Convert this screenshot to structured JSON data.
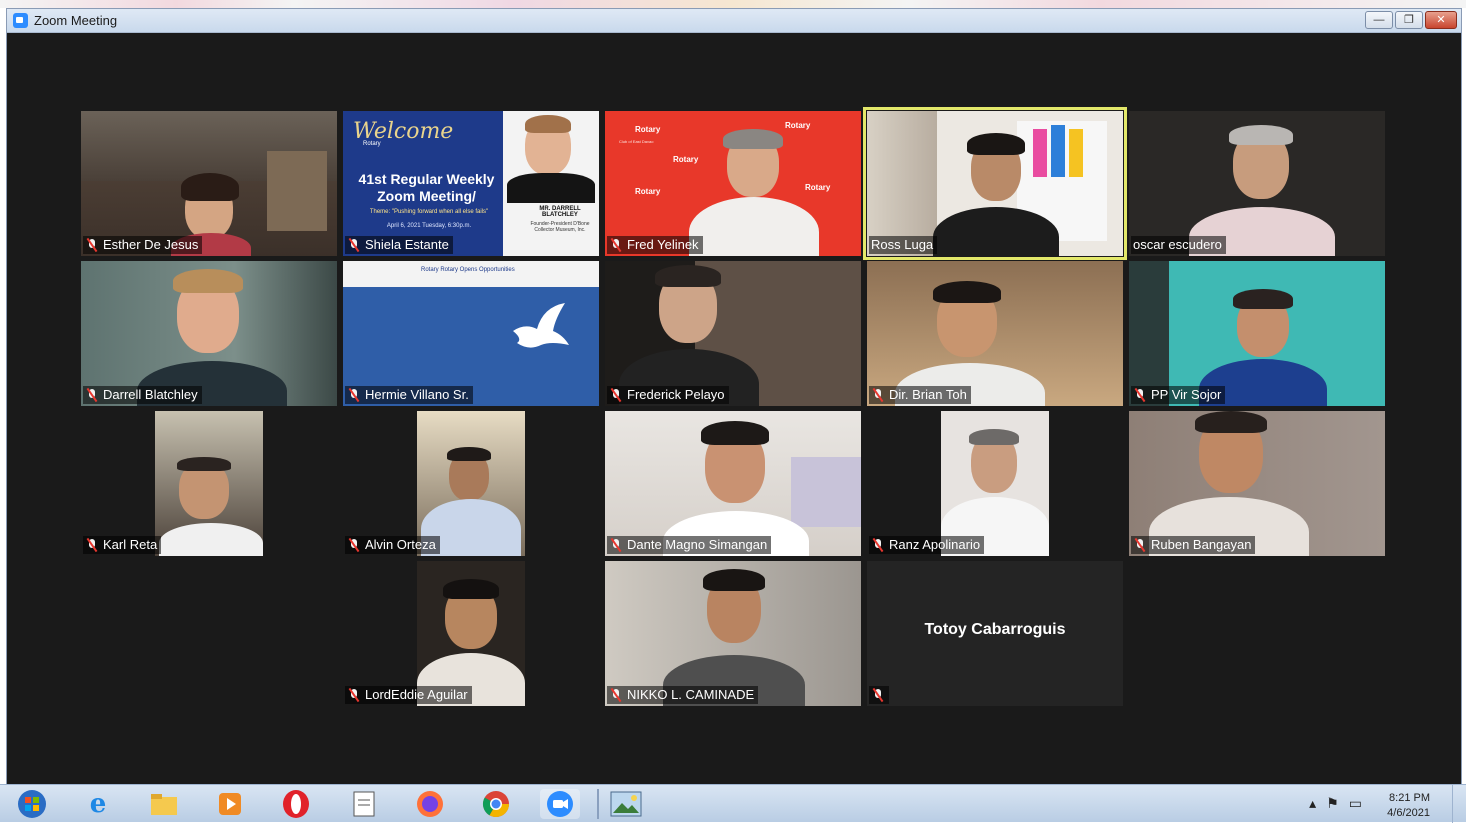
{
  "window": {
    "title": "Zoom Meeting",
    "buttons": {
      "minimize": "—",
      "restore": "❐",
      "close": "✕"
    }
  },
  "participants": [
    {
      "name": "Esther De Jesus",
      "muted": true
    },
    {
      "name": "Shiela Estante",
      "muted": true
    },
    {
      "name": "Fred Yelinek",
      "muted": true
    },
    {
      "name": "Ross Luga",
      "muted": false,
      "active_speaker": true
    },
    {
      "name": "oscar escudero",
      "muted": false
    },
    {
      "name": "Darrell Blatchley",
      "muted": true
    },
    {
      "name": "Hermie Villano Sr.",
      "muted": true
    },
    {
      "name": "Frederick Pelayo",
      "muted": true
    },
    {
      "name": "Dir. Brian Toh",
      "muted": true
    },
    {
      "name": "PP Vir Sojor",
      "muted": true
    },
    {
      "name": "Karl Reta",
      "muted": true
    },
    {
      "name": "Alvin Orteza",
      "muted": true
    },
    {
      "name": "Dante Magno Simangan",
      "muted": true
    },
    {
      "name": "Ranz Apolinario",
      "muted": true
    },
    {
      "name": "Ruben Bangayan",
      "muted": true
    },
    {
      "name": "LordEddie Aguilar",
      "muted": true
    },
    {
      "name": "NIKKO L. CAMINADE",
      "muted": true
    },
    {
      "name": "Totoy Cabarroguis",
      "muted": true,
      "video_off": true
    }
  ],
  "welcome_slide": {
    "heading": "Welcome",
    "rotary": "Rotary",
    "line1": "41st Regular Weekly Zoom Meeting/",
    "theme": "Theme: \"Pushing forward when all else fails\"",
    "date": "April 6, 2021 Tuesday, 6:30p.m.",
    "speaker_name": "MR. DARRELL BLATCHLEY",
    "speaker_desc": "Founder-President D'Bone Collector Museum, Inc."
  },
  "dove_slide": {
    "header": "Rotary    Rotary Opens Opportunities"
  },
  "rotary_backdrop": {
    "logo": "Rotary",
    "sub": "Club of East Davao"
  },
  "taskbar": {
    "icons": [
      "windows-start",
      "internet-explorer",
      "file-explorer",
      "media-player",
      "opera",
      "notepad",
      "firefox",
      "chrome",
      "zoom",
      "photo-viewer"
    ],
    "time": "8:21 PM",
    "date": "4/6/2021"
  },
  "colors": {
    "active_border": "#e3e86a",
    "muted_icon": "#e8372f",
    "zoom_blue": "#2d8cff"
  }
}
